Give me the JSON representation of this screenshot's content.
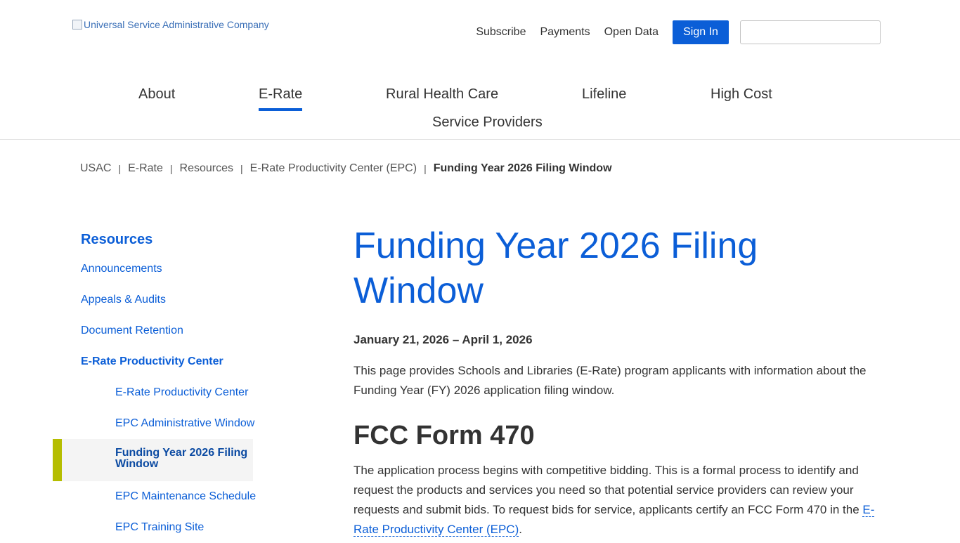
{
  "header": {
    "logo_alt": "Universal Service Administrative Company",
    "utility_links": [
      "Subscribe",
      "Payments",
      "Open Data"
    ],
    "sign_in_label": "Sign In",
    "search_placeholder": ""
  },
  "main_nav": {
    "items": [
      {
        "label": "About"
      },
      {
        "label": "E-Rate",
        "active": true
      },
      {
        "label": "Rural Health Care"
      },
      {
        "label": "Lifeline"
      },
      {
        "label": "High Cost"
      },
      {
        "label": "Service Providers"
      }
    ],
    "active_color": "#0b5ed7"
  },
  "breadcrumb": {
    "items": [
      "USAC",
      "E-Rate",
      "Resources",
      "E-Rate Productivity Center (EPC)"
    ],
    "current": "Funding Year 2026 Filing Window",
    "separator": "|"
  },
  "sidebar": {
    "title": "Resources",
    "items": [
      "Announcements",
      "Appeals & Audits",
      "Document Retention"
    ],
    "section": "E-Rate Productivity Center",
    "sub_items": [
      "E-Rate Productivity Center",
      "EPC Administrative Window"
    ],
    "active_item": "Funding Year 2026 Filing Window",
    "sub_items_after": [
      "EPC Maintenance Schedule",
      "EPC Training Site"
    ],
    "active_marker_color": "#b5bd00"
  },
  "content": {
    "title": "Funding Year 2026 Filing Window",
    "date_range": "January 21, 2026 – April 1, 2026",
    "intro": "This page provides Schools and Libraries (E-Rate) program applicants with information about the Funding Year (FY) 2026 application filing window.",
    "section_title": "FCC Form 470",
    "section_body_before_link": "The application process begins with competitive bidding. This is a formal process to identify and request the products and services you need so that potential service providers can review your requests and submit bids. To request bids for service, applicants certify an FCC Form 470 in the ",
    "section_link": "E-Rate Productivity Center (EPC)",
    "section_body_after_link": "."
  },
  "colors": {
    "brand_blue": "#0b5ed7",
    "text": "#333333"
  }
}
